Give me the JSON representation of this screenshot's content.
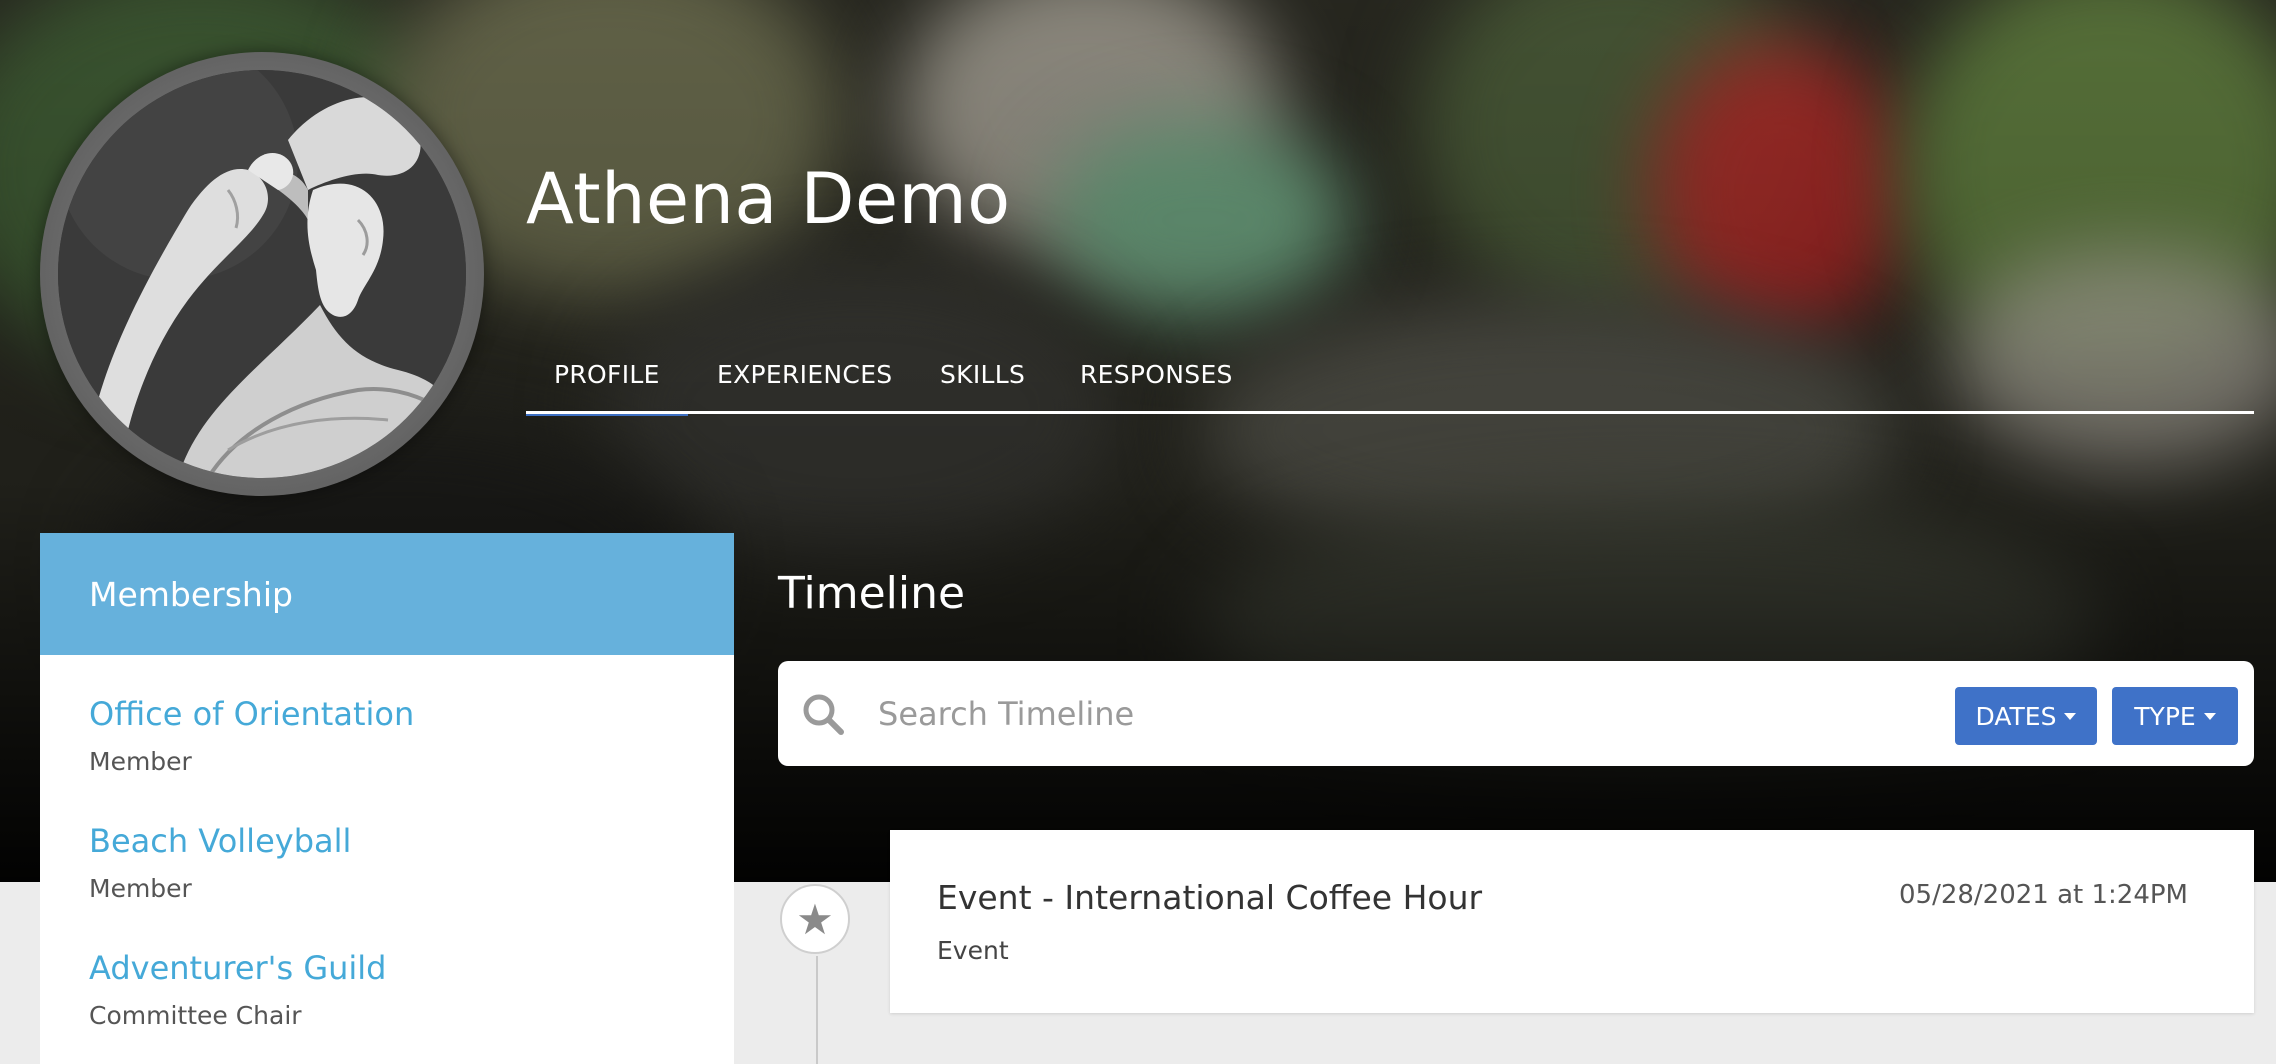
{
  "profile": {
    "name": "Athena Demo"
  },
  "tabs": [
    {
      "label": "PROFILE",
      "active": true
    },
    {
      "label": "EXPERIENCES",
      "active": false
    },
    {
      "label": "SKILLS",
      "active": false
    },
    {
      "label": "RESPONSES",
      "active": false
    }
  ],
  "membership": {
    "header": "Membership",
    "items": [
      {
        "organization": "Office of Orientation",
        "role": "Member"
      },
      {
        "organization": "Beach Volleyball",
        "role": "Member"
      },
      {
        "organization": "Adventurer's Guild",
        "role": "Committee Chair"
      }
    ]
  },
  "timeline": {
    "title": "Timeline",
    "search_placeholder": "Search Timeline",
    "dates_button": "DATES",
    "type_button": "TYPE",
    "events": [
      {
        "title": "Event - International Coffee Hour",
        "type": "Event",
        "date": "05/28/2021 at 1:24PM",
        "icon": "star-icon"
      }
    ]
  },
  "colors": {
    "accent": "#3f72c8",
    "sidebar_header": "#66b1dc",
    "link": "#45a9d8",
    "active_tab_underline": "#3d6fc2"
  }
}
